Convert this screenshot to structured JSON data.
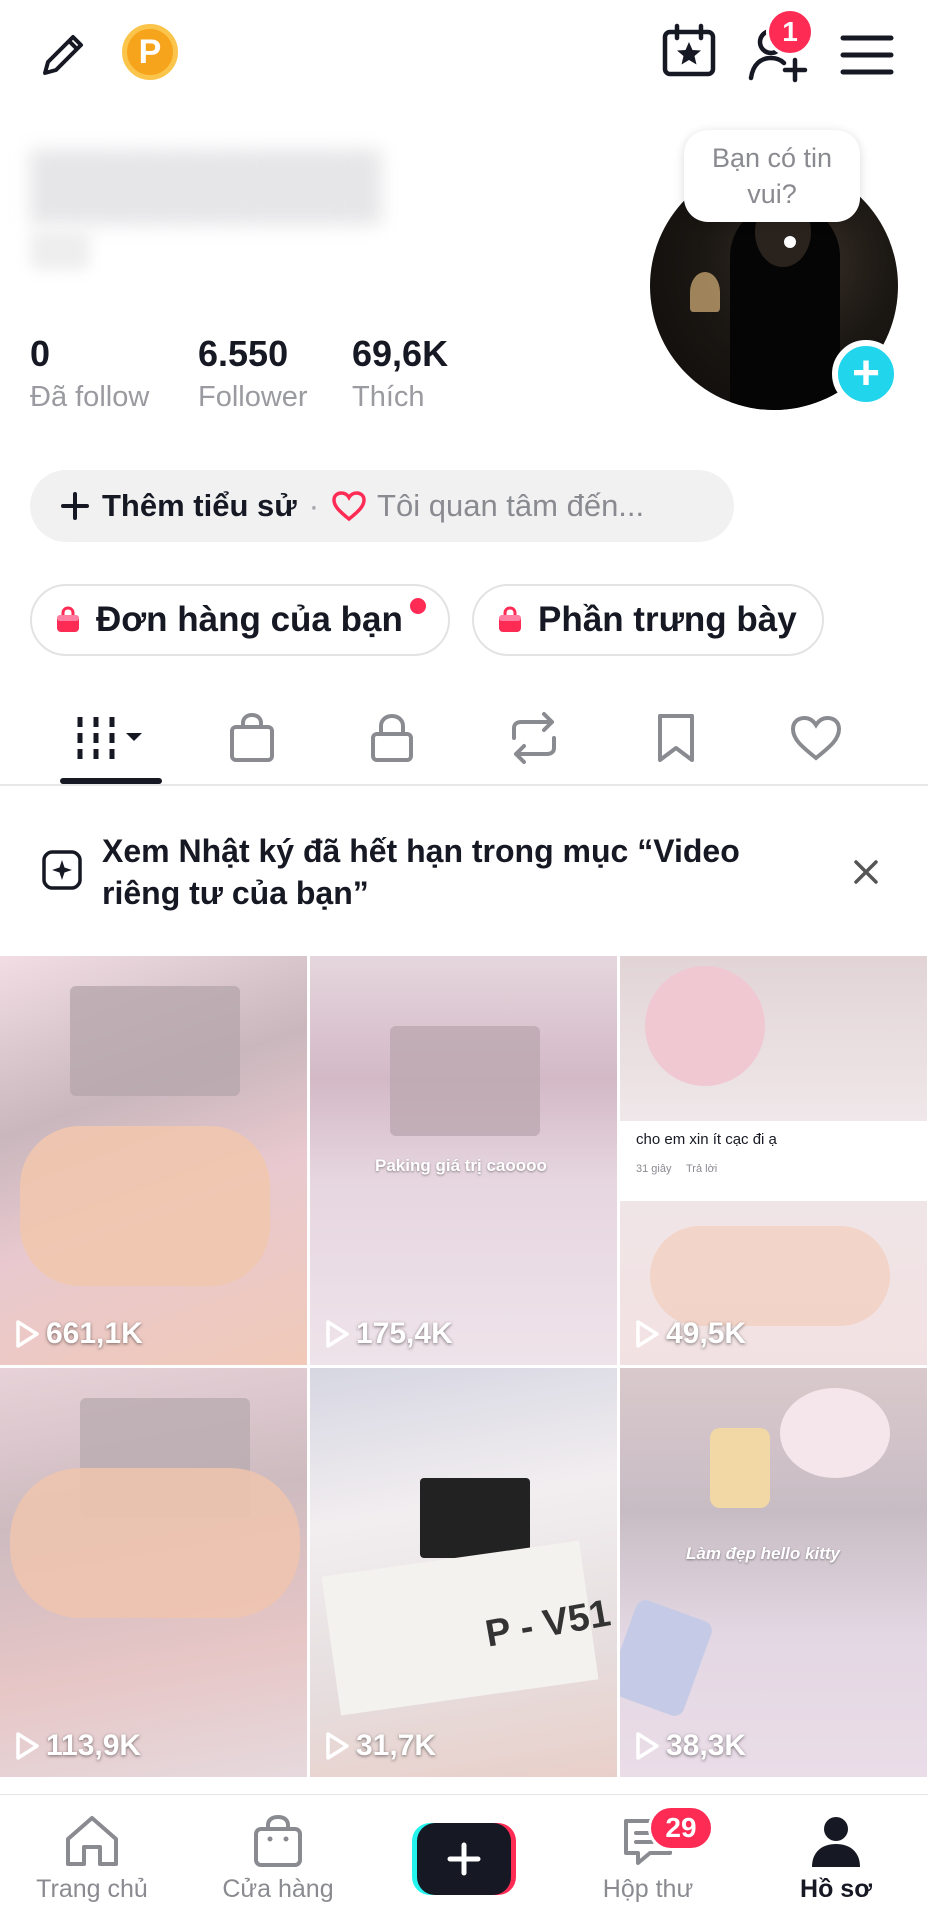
{
  "top_bar": {
    "coin_label": "P",
    "add_friend_badge": "1"
  },
  "profile": {
    "avatar_bubble": "Bạn có tin vui?",
    "add_avatar_symbol": "+"
  },
  "stats": [
    {
      "value": "0",
      "label": "Đã follow"
    },
    {
      "value": "6.550",
      "label": "Follower"
    },
    {
      "value": "69,6K",
      "label": "Thích"
    }
  ],
  "bio": {
    "add_label": "Thêm tiểu sử",
    "separator": "·",
    "interest_label": "Tôi quan tâm đến..."
  },
  "shop": {
    "orders_label": "Đơn hàng của bạn",
    "showcase_label": "Phần trưng bày"
  },
  "notice": {
    "text": "Xem Nhật ký đã hết hạn trong mục “Video riêng tư của bạn”"
  },
  "videos": [
    {
      "views": "661,1K",
      "caption": ""
    },
    {
      "views": "175,4K",
      "caption": "Paking giá trị caoooo"
    },
    {
      "views": "49,5K",
      "caption": "cho em xin ít cạc đi ạ",
      "meta": "31 giây",
      "reply": "Trả lời"
    },
    {
      "views": "113,9K",
      "caption": ""
    },
    {
      "views": "31,7K",
      "caption": "P - V51"
    },
    {
      "views": "38,3K",
      "caption": "Làm đẹp hello kitty"
    }
  ],
  "bottom_nav": {
    "home": "Trang chủ",
    "shop": "Cửa hàng",
    "inbox": "Hộp thư",
    "inbox_badge": "29",
    "profile": "Hồ sơ"
  },
  "colors": {
    "accent_red": "#fe2c55",
    "accent_cyan": "#20d5ec",
    "coin_orange": "#f7a41d"
  }
}
